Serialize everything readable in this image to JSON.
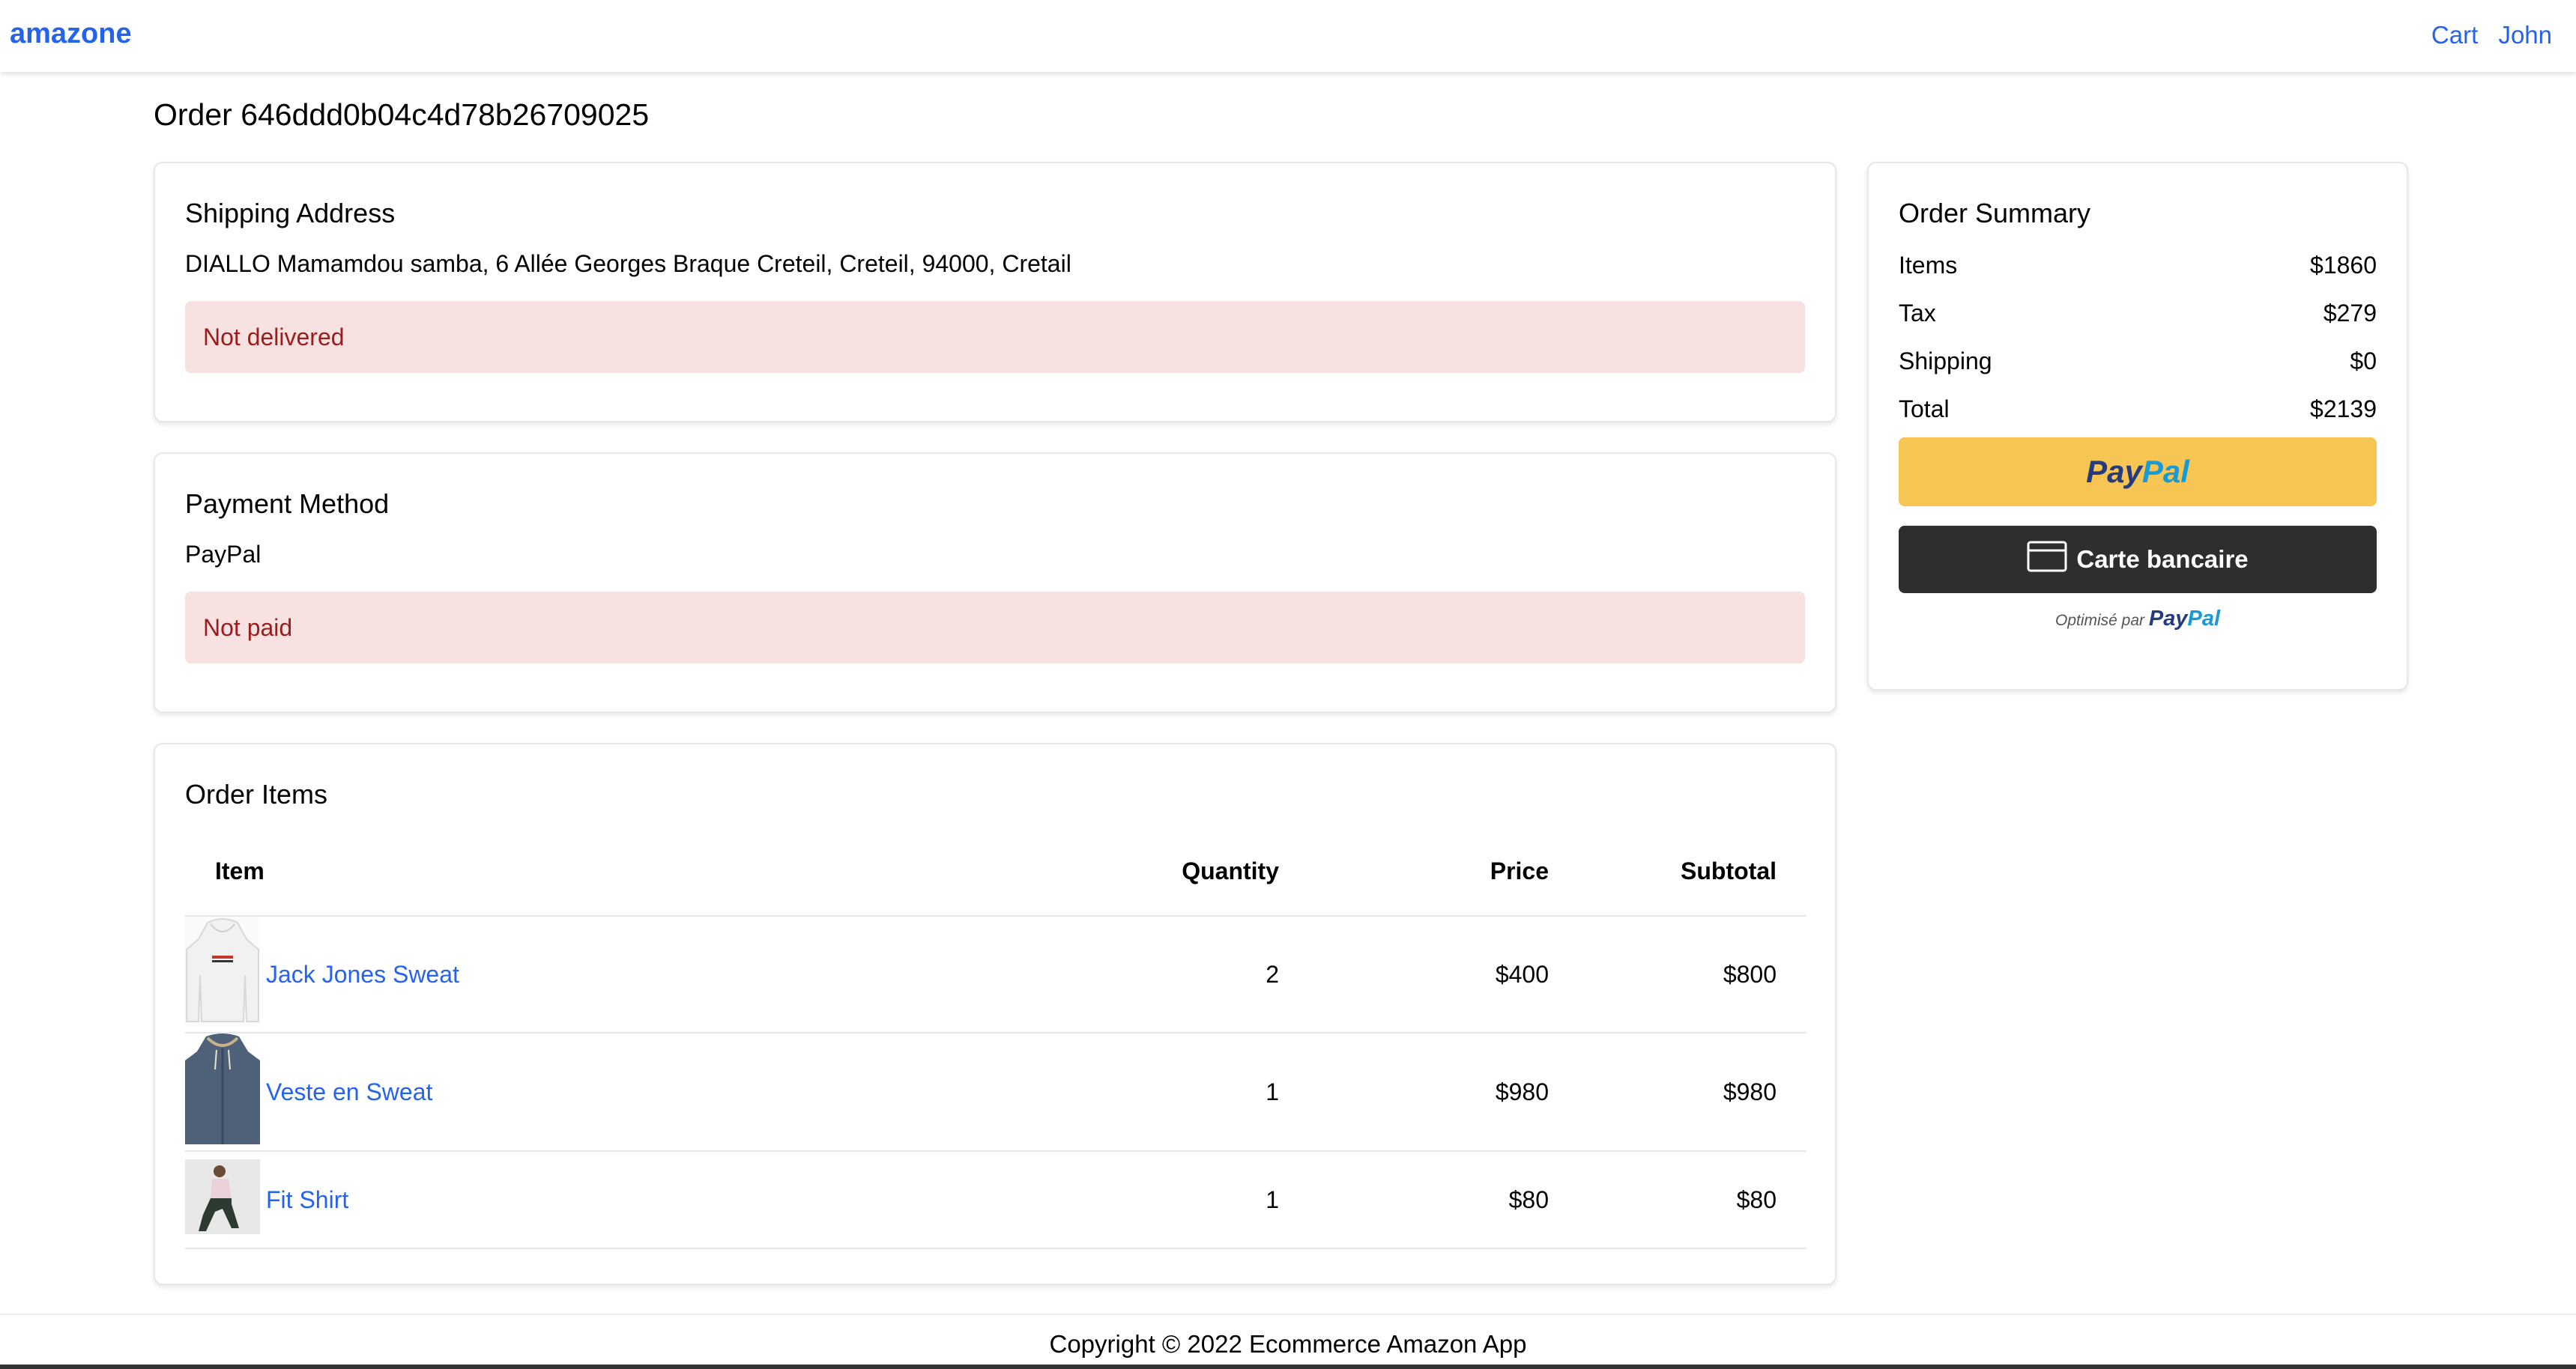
{
  "header": {
    "brand": "amazone",
    "cart_label": "Cart",
    "user_label": "John"
  },
  "order": {
    "title": "Order 646ddd0b04c4d78b26709025"
  },
  "shipping": {
    "title": "Shipping Address",
    "address": "DIALLO Mamamdou samba, 6 Allée Georges Braque Creteil, Creteil, 94000, Cretail",
    "status": "Not delivered"
  },
  "payment": {
    "title": "Payment Method",
    "method": "PayPal",
    "status": "Not paid"
  },
  "items": {
    "title": "Order Items",
    "headers": {
      "item": "Item",
      "quantity": "Quantity",
      "price": "Price",
      "subtotal": "Subtotal"
    },
    "rows": [
      {
        "name": "Jack Jones Sweat",
        "quantity": "2",
        "price": "$400",
        "subtotal": "$800"
      },
      {
        "name": "Veste en Sweat",
        "quantity": "1",
        "price": "$980",
        "subtotal": "$980"
      },
      {
        "name": "Fit Shirt",
        "quantity": "1",
        "price": "$80",
        "subtotal": "$80"
      }
    ]
  },
  "summary": {
    "title": "Order Summary",
    "items_label": "Items",
    "items_value": "$1860",
    "tax_label": "Tax",
    "tax_value": "$279",
    "shipping_label": "Shipping",
    "shipping_value": "$0",
    "total_label": "Total",
    "total_value": "$2139",
    "paypal_pay": "Pay",
    "paypal_pal": "Pal",
    "card_button": "Carte bancaire",
    "powered_by": "Optimisé par",
    "powered_pay": "Pay",
    "powered_pal": "Pal"
  },
  "colors": {
    "link": "#2563eb",
    "alert_bg": "#f8e1e1",
    "alert_text": "#9b1c1c",
    "paypal_yellow": "#f6c554",
    "card_dark": "#2c2e2f"
  },
  "footer": {
    "copyright": "Copyright © 2022 Ecommerce Amazon App"
  }
}
